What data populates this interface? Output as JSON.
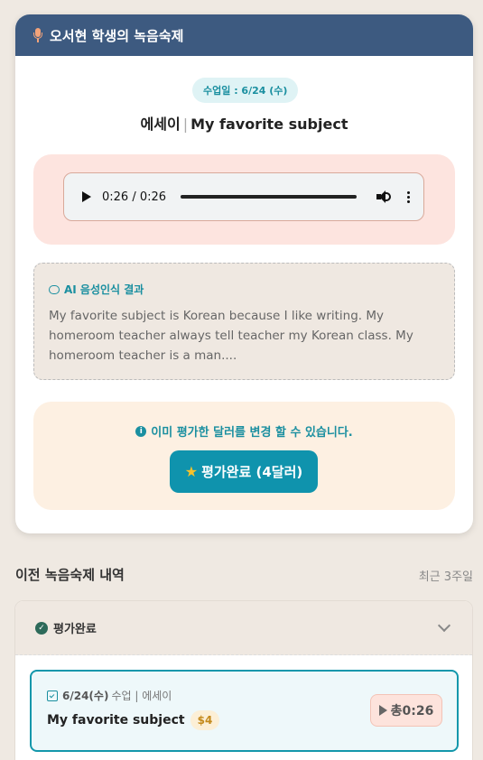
{
  "header": {
    "title": "오서현 학생의 녹음숙제"
  },
  "assignment": {
    "date_badge": "수업일 : 6/24 (수)",
    "type": "에세이",
    "separator": "|",
    "topic": "My favorite subject"
  },
  "player": {
    "time": "0:26 / 0:26",
    "progress": 1.0
  },
  "ai": {
    "title": "AI 음성인식 결과",
    "text": "My favorite subject is Korean because I like writing. My homeroom teacher always tell teacher my Korean class. My homeroom teacher is a man...."
  },
  "evaluation": {
    "notice": "이미 평가한 달러를 변경 할 수 있습니다.",
    "button_label": "평가완료 (4달러)"
  },
  "history": {
    "title": "이전 녹음숙제 내역",
    "period": "최근 3주일",
    "group_label": "평가완료",
    "items": [
      {
        "date": "6/24(수)",
        "meta": "수업 | 에세이",
        "title": "My favorite subject",
        "price": "$4",
        "total": "총0:26"
      }
    ]
  },
  "colors": {
    "header": "#3d5a80",
    "accent": "#0f93ad",
    "star": "#f7c22b"
  }
}
